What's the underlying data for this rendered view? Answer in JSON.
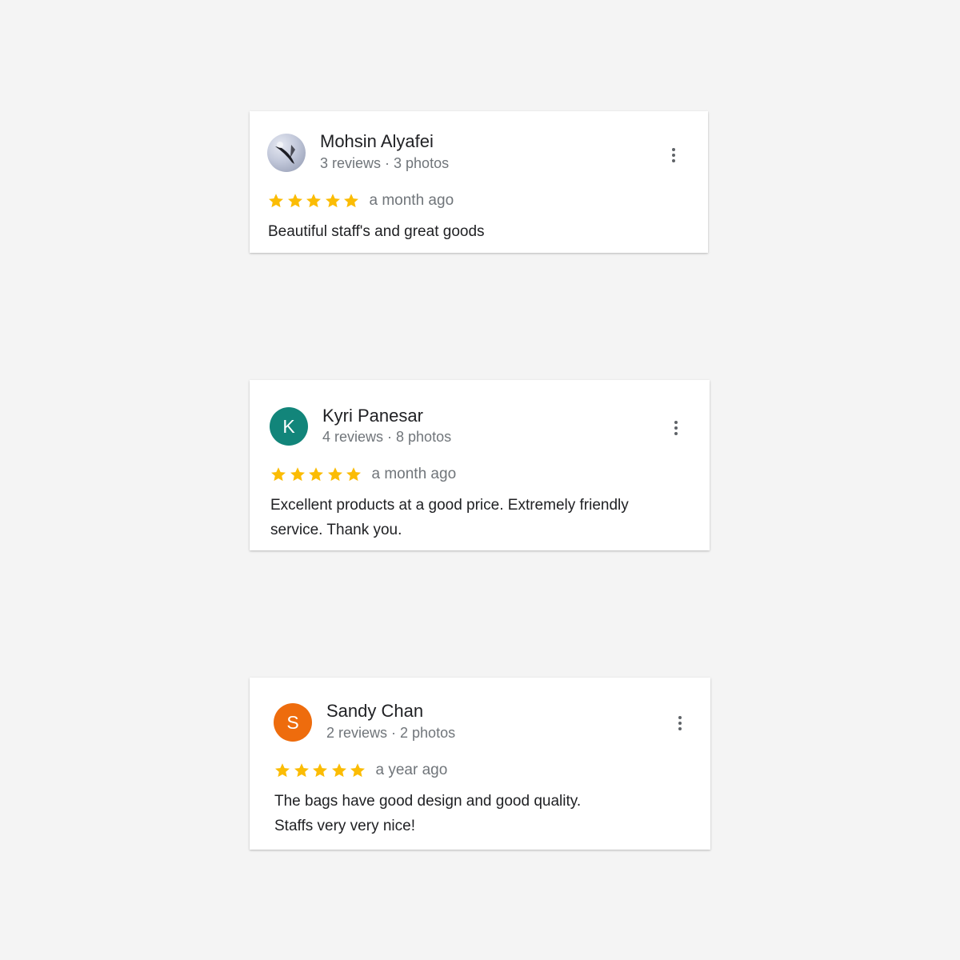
{
  "colors": {
    "background": "#f4f4f4",
    "card": "#ffffff",
    "star": "#fbbc04",
    "name_text": "#202124",
    "meta_text": "#70757a"
  },
  "reviews": [
    {
      "name": "Mohsin Alyafei",
      "meta": "3 reviews · 3 photos",
      "avatar": {
        "type": "photo",
        "letter": "",
        "color": ""
      },
      "rating": 5,
      "time": "a month ago",
      "text": "Beautiful staff's and great goods",
      "menu_icon": "more-vert-icon"
    },
    {
      "name": "Kyri Panesar",
      "meta": "4 reviews · 8 photos",
      "avatar": {
        "type": "letter",
        "letter": "K",
        "color": "#12857a"
      },
      "rating": 5,
      "time": "a month ago",
      "text": "Excellent products at a good price. Extremely friendly\nservice. Thank you.",
      "menu_icon": "more-vert-icon"
    },
    {
      "name": "Sandy Chan",
      "meta": "2 reviews · 2 photos",
      "avatar": {
        "type": "letter",
        "letter": "S",
        "color": "#ee6c0d"
      },
      "rating": 5,
      "time": "a year ago",
      "text": "The bags have good design and good quality.\nStaffs very very nice!",
      "menu_icon": "more-vert-icon"
    }
  ]
}
